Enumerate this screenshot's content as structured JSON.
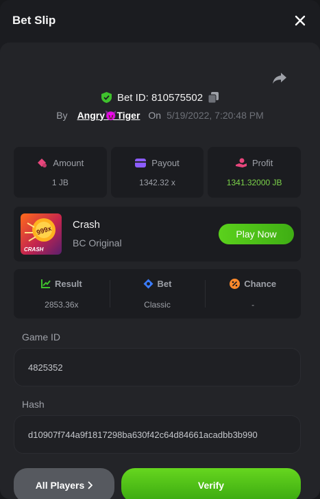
{
  "header": {
    "title": "Bet Slip"
  },
  "bet": {
    "id_label": "Bet ID: 810575502",
    "by_label": "By",
    "user": "Angry😈Tiger",
    "on_label": "On",
    "timestamp": "5/19/2022, 7:20:48 PM"
  },
  "stats": {
    "amount_label": "Amount",
    "amount_value": "1 JB",
    "payout_label": "Payout",
    "payout_value": "1342.32 x",
    "profit_label": "Profit",
    "profit_value": "1341.32000 JB"
  },
  "game": {
    "name": "Crash",
    "subtitle": "BC Original",
    "thumb_multiplier": "999x",
    "thumb_title": "CRASH",
    "play_label": "Play Now"
  },
  "details": {
    "result_label": "Result",
    "result_value": "2853.36x",
    "bet_label": "Bet",
    "bet_value": "Classic",
    "chance_label": "Chance",
    "chance_value": "-"
  },
  "fields": {
    "game_id_label": "Game ID",
    "game_id_value": "4825352",
    "hash_label": "Hash",
    "hash_value": "d10907f744a9f1817298ba630f42c64d84661acadbb3b990"
  },
  "actions": {
    "all_players_label": "All Players",
    "verify_label": "Verify"
  },
  "colors": {
    "accent_green": "#5bd11c",
    "profit_green": "#7cd34a",
    "shield_green": "#3fc12d",
    "amount_pink": "#e8467c",
    "payout_purple": "#8c5cff",
    "bet_blue": "#3b7cff",
    "chance_orange": "#ff8a2b"
  }
}
